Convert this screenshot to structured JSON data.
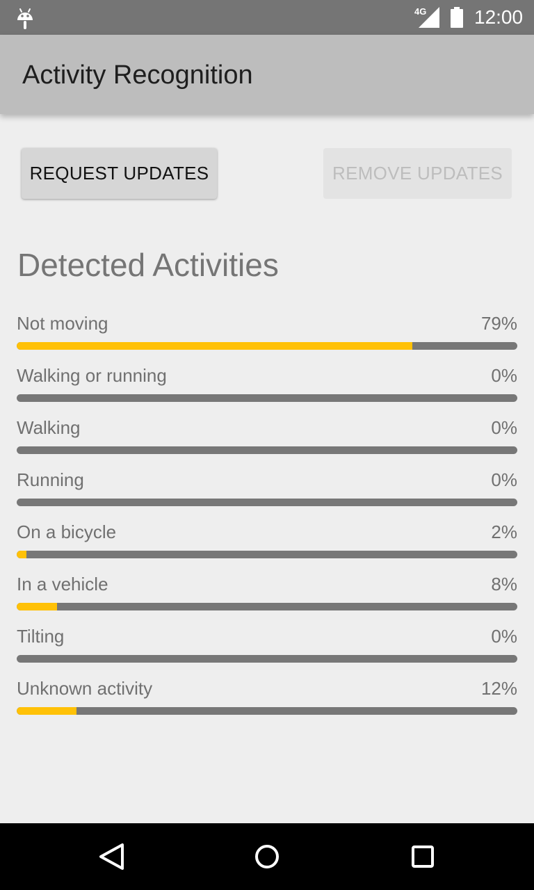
{
  "status_bar": {
    "network_label": "4G",
    "time": "12:00",
    "icons": [
      "android-icon",
      "signal-icon",
      "battery-icon"
    ]
  },
  "app_bar": {
    "title": "Activity Recognition"
  },
  "buttons": {
    "request_label": "REQUEST UPDATES",
    "remove_label": "REMOVE UPDATES",
    "remove_enabled": false
  },
  "section": {
    "title": "Detected Activities"
  },
  "activities": [
    {
      "label": "Not moving",
      "percent_text": "79%",
      "confidence": 79
    },
    {
      "label": "Walking or running",
      "percent_text": "0%",
      "confidence": 0
    },
    {
      "label": "Walking",
      "percent_text": "0%",
      "confidence": 0
    },
    {
      "label": "Running",
      "percent_text": "0%",
      "confidence": 0
    },
    {
      "label": "On a bicycle",
      "percent_text": "2%",
      "confidence": 2
    },
    {
      "label": "In a vehicle",
      "percent_text": "8%",
      "confidence": 8
    },
    {
      "label": "Tilting",
      "percent_text": "0%",
      "confidence": 0
    },
    {
      "label": "Unknown activity",
      "percent_text": "12%",
      "confidence": 12
    }
  ],
  "nav_bar": {
    "icons": [
      "back-icon",
      "home-icon",
      "recents-icon"
    ]
  },
  "colors": {
    "progress_fill": "#ffc107",
    "progress_track": "#777777",
    "app_bar": "#bdbdbd",
    "status_bar": "#757575"
  }
}
